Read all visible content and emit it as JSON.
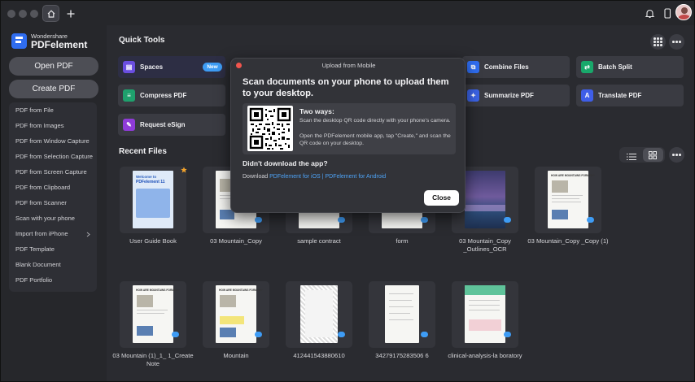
{
  "app": {
    "brand_small": "Wondershare",
    "brand_large": "PDFelement"
  },
  "sidebar": {
    "open_pdf": "Open PDF",
    "create_pdf": "Create PDF",
    "items": [
      "PDF from File",
      "PDF from Images",
      "PDF from Window Capture",
      "PDF from Selection Capture",
      "PDF from Screen Capture",
      "PDF from Clipboard",
      "PDF from Scanner",
      "Scan with your phone",
      "Import from iPhone",
      "PDF Template",
      "Blank Document",
      "PDF Portfolio"
    ]
  },
  "quick_tools": {
    "title": "Quick Tools",
    "spaces": "Spaces",
    "new_badge": "New",
    "compress": "Compress PDF",
    "request_esign": "Request eSign",
    "combine": "Combine Files",
    "batch_split": "Batch Split",
    "summarize": "Summarize PDF",
    "translate": "Translate PDF"
  },
  "recent": {
    "title": "Recent Files",
    "row1": [
      "User Guide Book",
      "03 Mountain_Copy",
      "sample contract",
      "form",
      "03 Mountain_Copy _Outlines_OCR",
      "03 Mountain_Copy _Copy (1)"
    ],
    "row2": [
      "03 Mountain (1)_1_ 1_Create Note",
      "Mountain",
      "412441543880610",
      "34279175283506 6",
      "clinical-analysis-la boratory"
    ],
    "thumb_welcome": "Welcome to",
    "thumb_product": "PDFelement 11",
    "thumb_heading": "HOW ARE MOUNTAINS FORMED?"
  },
  "modal": {
    "title": "Upload from Mobile",
    "heading": "Scan documents on your phone to upload them to your desktop.",
    "two_ways": "Two ways:",
    "way1": "Scan the desktop QR code directly with your phone's camera.",
    "way2": "Open the PDFelement mobile app, tap \"Create,\" and scan the QR code on your desktop.",
    "no_app": "Didn't download the app?",
    "download": "Download",
    "ios_link": "PDFelement for iOS",
    "separator": "|",
    "android_link": "PDFelement for Android",
    "close": "Close"
  },
  "colors": {
    "accent_blue": "#3e9cf5",
    "spaces": "#6a4ee0",
    "compress": "#1fa16d",
    "esign": "#8f3bd8",
    "combine": "#2f6df0",
    "split": "#19a86b",
    "summarize": "#3b63e6",
    "translate": "#3f5ee8",
    "star": "#f2a22a",
    "red_dot": "#f0554d"
  }
}
